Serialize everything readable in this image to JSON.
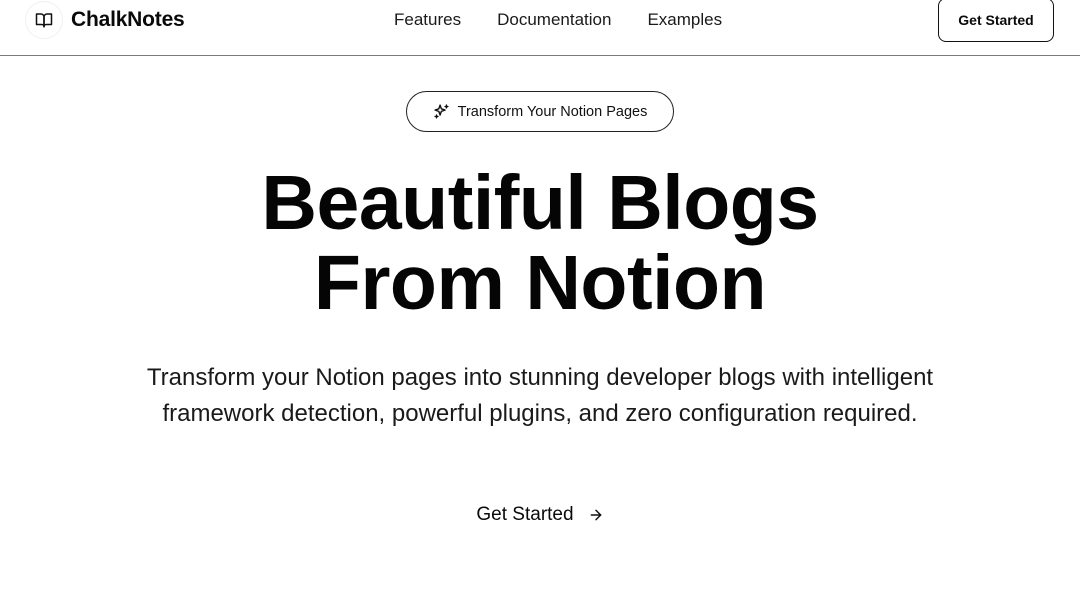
{
  "header": {
    "brand_name": "ChalkNotes",
    "brand_icon": "book-open-icon",
    "nav": [
      {
        "label": "Features"
      },
      {
        "label": "Documentation"
      },
      {
        "label": "Examples"
      }
    ],
    "cta_label": "Get Started"
  },
  "hero": {
    "badge_icon": "sparkles-icon",
    "badge_label": "Transform Your Notion Pages",
    "headline_line1": "Beautiful Blogs",
    "headline_line2": "From Notion",
    "subtitle": "Transform your Notion pages into stunning developer blogs with intelligent framework detection, powerful plugins, and zero configuration required.",
    "cta_label": "Get Started",
    "cta_icon": "arrow-right-icon"
  },
  "colors": {
    "text": "#0a0a0a",
    "border": "#7a7a7a",
    "background": "#ffffff"
  }
}
